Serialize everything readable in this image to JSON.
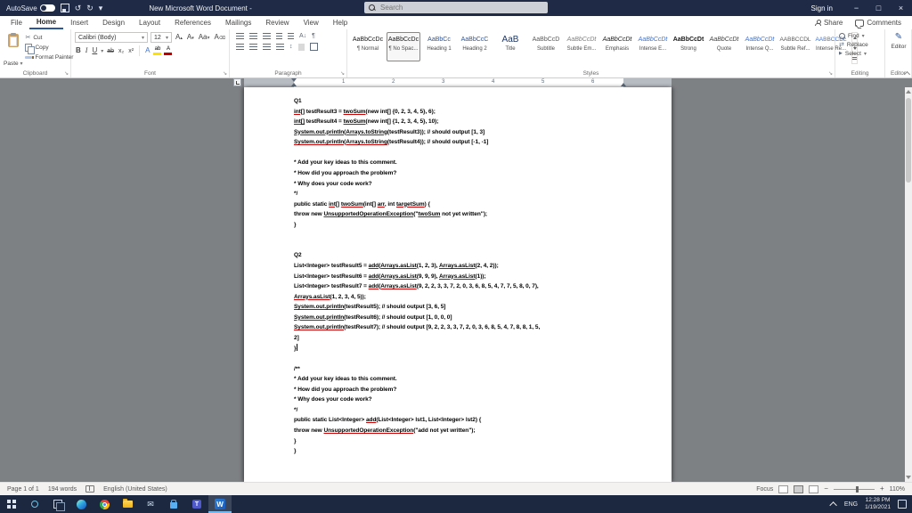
{
  "title_bar": {
    "autosave_label": "AutoSave",
    "autosave_state": "Off",
    "undo_glyph": "↺",
    "redo_glyph": "↻",
    "qat_more_glyph": "▾",
    "title": "New Microsoft Word Document -",
    "search_placeholder": "Search",
    "sign_in_label": "Sign in",
    "minimize_glyph": "−",
    "maximize_glyph": "□",
    "close_glyph": "×"
  },
  "tab_bar": {
    "tabs": [
      "File",
      "Home",
      "Insert",
      "Design",
      "Layout",
      "References",
      "Mailings",
      "Review",
      "View",
      "Help"
    ],
    "active_tab": "Home",
    "share_label": "Share",
    "comments_label": "Comments"
  },
  "ribbon": {
    "launcher_glyph": "↘",
    "dropdown_glyph": "▾",
    "clipboard": {
      "label": "Clipboard",
      "paste": "Paste",
      "cut": "Cut",
      "copy": "Copy",
      "format_painter": "Format Painter",
      "cut_glyph": "✂"
    },
    "font": {
      "label": "Font",
      "family": "Calibri (Body)",
      "size": "12",
      "bold_glyph": "B",
      "italic_glyph": "I",
      "underline_glyph": "U",
      "strikethrough_glyph": "ab",
      "subscript_glyph": "x₂",
      "superscript_glyph": "x²",
      "text_effects_glyph": "A",
      "case_glyph": "Aa",
      "grow_glyph": "A",
      "shrink_glyph": "A",
      "clear_glyph": "A",
      "highlight_glyph": "ab",
      "font_color_glyph": "A"
    },
    "paragraph": {
      "label": "Paragraph",
      "sort_glyph": "A↓",
      "pilcrow_glyph": "¶",
      "line_spacing_glyph": "↕"
    },
    "styles": {
      "label": "Styles",
      "selected_index": 1,
      "items": [
        {
          "preview": "AaBbCcDc",
          "label": "¶ Normal"
        },
        {
          "preview": "AaBbCcDc",
          "label": "¶ No Spac..."
        },
        {
          "preview": "AaBbCc",
          "label": "Heading 1"
        },
        {
          "preview": "AaBbCcC",
          "label": "Heading 2"
        },
        {
          "preview": "AaB",
          "label": "Title"
        },
        {
          "preview": "AaBbCcD",
          "label": "Subtitle"
        },
        {
          "preview": "AaBbCcDt",
          "label": "Subtle Em..."
        },
        {
          "preview": "AaBbCcDt",
          "label": "Emphasis"
        },
        {
          "preview": "AaBbCcDt",
          "label": "Intense E..."
        },
        {
          "preview": "AaBbCcDt",
          "label": "Strong"
        },
        {
          "preview": "AaBbCcDt",
          "label": "Quote"
        },
        {
          "preview": "AaBbCcDt",
          "label": "Intense Q..."
        },
        {
          "preview": "AABBCCDL",
          "label": "Subtle Ref..."
        },
        {
          "preview": "AABBCCDL",
          "label": "Intense Re..."
        }
      ]
    },
    "editing": {
      "label": "Editing",
      "find": "Find",
      "replace": "Replace",
      "select": "Select",
      "replace_glyph": "⇄",
      "select_glyph": "▶"
    },
    "editor": {
      "label": "Editor",
      "button": "Editor",
      "icon_glyph": "✎"
    }
  },
  "ruler": {
    "numbers": [
      "1",
      "2",
      "3",
      "4",
      "5",
      "6"
    ]
  },
  "document": {
    "lines": [
      {
        "segments": [
          {
            "t": "Q1",
            "u": false
          }
        ]
      },
      {
        "segments": [
          {
            "t": "int[]",
            "u": true
          },
          {
            "t": " testResult3 = ",
            "u": false
          },
          {
            "t": "twoSum",
            "u": true
          },
          {
            "t": "(new int[] {0, 2, 3, 4, 5}, 6);",
            "u": false
          }
        ]
      },
      {
        "segments": [
          {
            "t": "int[]",
            "u": true
          },
          {
            "t": " testResult4 = ",
            "u": false
          },
          {
            "t": "twoSum",
            "u": true
          },
          {
            "t": "(new int[] {1, 2, 3, 4, 5}, 10);",
            "u": false
          }
        ]
      },
      {
        "segments": [
          {
            "t": "System.out.println",
            "u": true
          },
          {
            "t": "(",
            "u": false
          },
          {
            "t": "Arrays.toString",
            "u": true
          },
          {
            "t": "(testResult3)); // should output [1, 3]",
            "u": false
          }
        ]
      },
      {
        "segments": [
          {
            "t": "System.out.println",
            "u": true
          },
          {
            "t": "(",
            "u": false
          },
          {
            "t": "Arrays.toString",
            "u": true
          },
          {
            "t": "(testResult4)); // should output [-1, -1]",
            "u": false
          }
        ]
      },
      {
        "segments": []
      },
      {
        "segments": [
          {
            "t": "* Add your key ideas to this comment.",
            "u": false
          }
        ]
      },
      {
        "segments": [
          {
            "t": "* How did you approach the problem?",
            "u": false
          }
        ]
      },
      {
        "segments": [
          {
            "t": "* Why does your code work?",
            "u": false
          }
        ]
      },
      {
        "segments": [
          {
            "t": "*/",
            "u": false
          }
        ]
      },
      {
        "segments": [
          {
            "t": "public static ",
            "u": false
          },
          {
            "t": "int[]",
            "u": true
          },
          {
            "t": " ",
            "u": false
          },
          {
            "t": "twoSum",
            "u": true
          },
          {
            "t": "(int[] ",
            "u": false
          },
          {
            "t": "arr",
            "u": true
          },
          {
            "t": ", int ",
            "u": false
          },
          {
            "t": "targetSum",
            "u": true
          },
          {
            "t": ") {",
            "u": false
          }
        ]
      },
      {
        "segments": [
          {
            "t": "throw new ",
            "u": false
          },
          {
            "t": "UnsupportedOperationException",
            "u": true
          },
          {
            "t": "(\"",
            "u": false
          },
          {
            "t": "twoSum",
            "u": true
          },
          {
            "t": " not yet written\");",
            "u": false
          }
        ]
      },
      {
        "segments": [
          {
            "t": "}",
            "u": false
          }
        ]
      },
      {
        "segments": []
      },
      {
        "segments": []
      },
      {
        "segments": [
          {
            "t": "Q2",
            "u": false
          }
        ]
      },
      {
        "segments": [
          {
            "t": "List<Integer> testResult5 = ",
            "u": false
          },
          {
            "t": "add",
            "u": true
          },
          {
            "t": "(",
            "u": false
          },
          {
            "t": "Arrays.asList",
            "u": true
          },
          {
            "t": "(1, 2, 3), ",
            "u": false
          },
          {
            "t": "Arrays.asList",
            "u": true
          },
          {
            "t": "(2, 4, 2));",
            "u": false
          }
        ]
      },
      {
        "segments": [
          {
            "t": "List<Integer> testResult6 = ",
            "u": false
          },
          {
            "t": "add",
            "u": true
          },
          {
            "t": "(",
            "u": false
          },
          {
            "t": "Arrays.asList",
            "u": true
          },
          {
            "t": "(9, 9, 9), ",
            "u": false
          },
          {
            "t": "Arrays.asList",
            "u": true
          },
          {
            "t": "(1));",
            "u": false
          }
        ]
      },
      {
        "segments": [
          {
            "t": "List<Integer> testResult7 = ",
            "u": false
          },
          {
            "t": "add",
            "u": true
          },
          {
            "t": "(",
            "u": false
          },
          {
            "t": "Arrays.asList",
            "u": true
          },
          {
            "t": "(9, 2, 2, 3, 3, 7, 2, 0, 3, 6, 8, 5, 4, 7, 7, 5, 8, 0, 7),",
            "u": false
          }
        ]
      },
      {
        "segments": [
          {
            "t": "Arrays.asList",
            "u": true
          },
          {
            "t": "(1, 2, 3, 4, 5));",
            "u": false
          }
        ]
      },
      {
        "segments": [
          {
            "t": "System.out.println",
            "u": true
          },
          {
            "t": "(testResult5); // should output [3, 6, 5]",
            "u": false
          }
        ]
      },
      {
        "segments": [
          {
            "t": "System.out.println",
            "u": true
          },
          {
            "t": "(testResult6); // should output [1, 0, 0, 0]",
            "u": false
          }
        ]
      },
      {
        "segments": [
          {
            "t": "System.out.println",
            "u": true
          },
          {
            "t": "(testResult7); // should output [9, 2, 2, 3, 3, 7, 2, 0, 3, 6, 8, 5, 4, 7, 8, 8, 1, 5,",
            "u": false
          }
        ]
      },
      {
        "segments": [
          {
            "t": "2]",
            "u": false
          }
        ]
      },
      {
        "segments": [
          {
            "t": "}",
            "u": false
          }
        ],
        "caret": true
      },
      {
        "segments": []
      },
      {
        "segments": [
          {
            "t": "/**",
            "u": false
          }
        ]
      },
      {
        "segments": [
          {
            "t": "* Add your key ideas to this comment.",
            "u": false
          }
        ]
      },
      {
        "segments": [
          {
            "t": "* How did you approach the problem?",
            "u": false
          }
        ]
      },
      {
        "segments": [
          {
            "t": "* Why does your code work?",
            "u": false
          }
        ]
      },
      {
        "segments": [
          {
            "t": "*/",
            "u": false
          }
        ]
      },
      {
        "segments": [
          {
            "t": "public static List<Integer> ",
            "u": false
          },
          {
            "t": "add",
            "u": true
          },
          {
            "t": "(List<Integer> lst1, List<Integer> lst2) {",
            "u": false
          }
        ]
      },
      {
        "segments": [
          {
            "t": "throw new ",
            "u": false
          },
          {
            "t": "UnsupportedOperationException",
            "u": true
          },
          {
            "t": "(\"add not yet written\");",
            "u": false
          }
        ]
      },
      {
        "segments": [
          {
            "t": "}",
            "u": false
          }
        ]
      },
      {
        "segments": [
          {
            "t": "}",
            "u": false
          }
        ]
      }
    ]
  },
  "status_bar": {
    "page": "Page 1 of 1",
    "words": "194 words",
    "language": "English (United States)",
    "focus": "Focus",
    "zoom_out": "−",
    "zoom_in": "+",
    "zoom": "110%"
  },
  "taskbar": {
    "apps": [
      {
        "name": "start"
      },
      {
        "name": "search"
      },
      {
        "name": "task-view"
      },
      {
        "name": "edge"
      },
      {
        "name": "chrome"
      },
      {
        "name": "file-explorer"
      },
      {
        "name": "mail",
        "glyph": "✉"
      },
      {
        "name": "store"
      },
      {
        "name": "teams",
        "glyph": "T"
      },
      {
        "name": "word",
        "glyph": "W",
        "active": true
      }
    ],
    "tray": {
      "language": "ENG",
      "time": "12:28 PM",
      "date": "1/19/2021"
    }
  },
  "colors": {
    "accent": "#2b579a",
    "titlebar": "#1e2a46",
    "taskbar": "#1c2840",
    "misspell": "#d00000",
    "highlight": "#ffe100",
    "font_color": "#c00000"
  }
}
